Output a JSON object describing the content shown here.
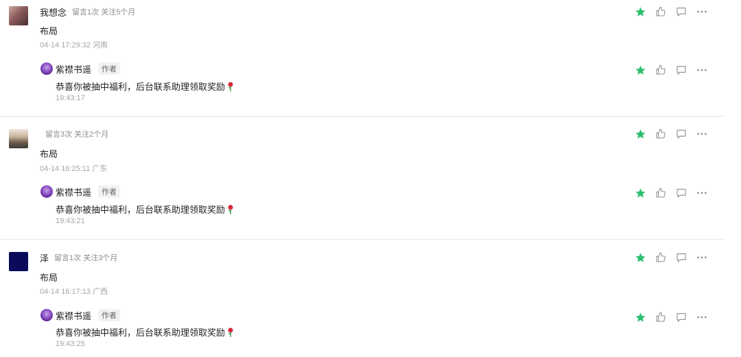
{
  "comments": [
    {
      "nickname": "我想念",
      "stats": "留言1次 关注5个月",
      "content": "布局",
      "time_location": "04-14 17:29:32 河南",
      "reply": {
        "author": "紫襟书遥",
        "badge": "作者",
        "content": "恭喜你被抽中福利，后台联系助理领取奖励",
        "time": "19:43:17"
      }
    },
    {
      "nickname": "",
      "stats": "留言3次 关注2个月",
      "content": "布局",
      "time_location": "04-14 16:25:11 广东",
      "reply": {
        "author": "紫襟书遥",
        "badge": "作者",
        "content": "恭喜你被抽中福利，后台联系助理领取奖励",
        "time": "19:43:21"
      }
    },
    {
      "nickname": "泽",
      "stats": "留言1次 关注3个月",
      "content": "布局",
      "time_location": "04-14 16:17:13 广西",
      "reply": {
        "author": "紫襟书遥",
        "badge": "作者",
        "content": "恭喜你被抽中福利，后台联系助理领取奖励",
        "time": "19:43:25"
      }
    }
  ],
  "icons": [
    "star-icon",
    "thumbs-up-icon",
    "comment-icon",
    "more-icon",
    "rose-icon"
  ],
  "colors": {
    "star": "#2bbf6f",
    "icon_gray": "#8c8c8c",
    "divider": "#e8e8e8"
  }
}
